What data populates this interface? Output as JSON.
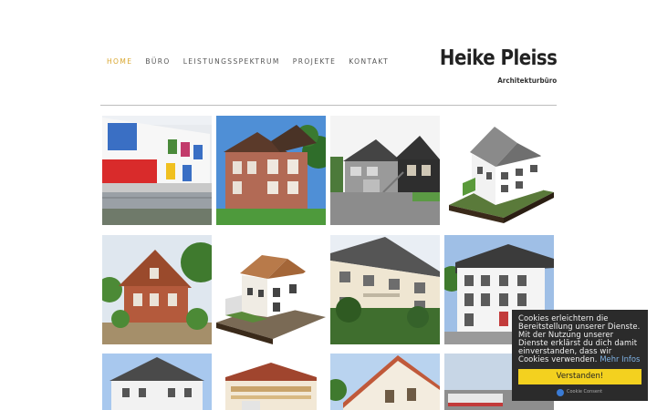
{
  "nav": {
    "items": [
      {
        "label": "HOME",
        "active": true
      },
      {
        "label": "BÜRO",
        "active": false
      },
      {
        "label": "LEISTUNGSSPEKTRUM",
        "active": false
      },
      {
        "label": "PROJEKTE",
        "active": false
      },
      {
        "label": "KONTAKT",
        "active": false
      }
    ]
  },
  "brand": {
    "title": "Heike Pleiss",
    "subtitle": "Architekturbüro"
  },
  "colors": {
    "accent": "#d9a62e",
    "cookie_bg": "#2b2b2b",
    "cookie_button": "#f3d11f",
    "cookie_link": "#7fb3e6"
  },
  "gallery": {
    "tiles": [
      {
        "name": "project-colorful-school"
      },
      {
        "name": "project-brick-villa"
      },
      {
        "name": "project-dark-gable-house"
      },
      {
        "name": "project-3d-model-white-house"
      },
      {
        "name": "project-brick-cottage"
      },
      {
        "name": "project-3d-model-hipped-house"
      },
      {
        "name": "project-apartment-block"
      },
      {
        "name": "project-modern-townhouse"
      },
      {
        "name": "project-hipped-roof-house"
      },
      {
        "name": "project-roof-section-model"
      },
      {
        "name": "project-gable-facade"
      },
      {
        "name": "project-flat-roof-building"
      }
    ]
  },
  "cookie": {
    "message": "Cookies erleichtern die Bereitstellung unserer Dienste. Mit der Nutzung unserer Dienste erklärst du dich damit einverstanden, dass wir Cookies verwenden.",
    "more_link": "Mehr Infos",
    "button": "Verstanden!",
    "brand": "Cookie Consent"
  }
}
